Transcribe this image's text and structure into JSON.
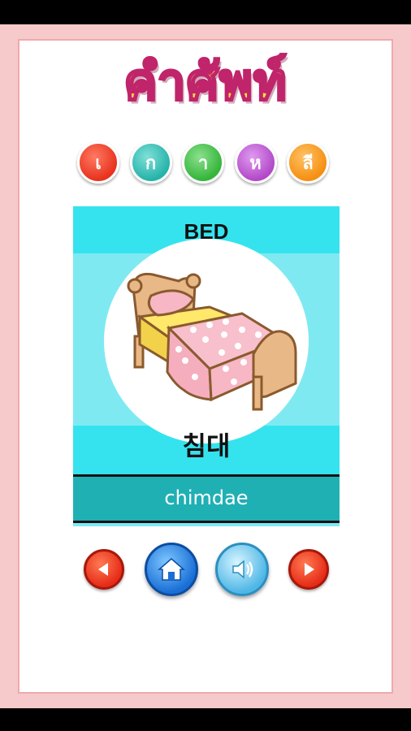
{
  "title": "คำศัพท์",
  "category_letters": [
    {
      "char": "เ",
      "color": "#e8321e"
    },
    {
      "char": "ก",
      "color": "#26b3a9"
    },
    {
      "char": "า",
      "color": "#35b53a"
    },
    {
      "char": "ห",
      "color": "#b249c8"
    },
    {
      "char": "ลี",
      "color": "#f58f12"
    }
  ],
  "card": {
    "english": "BED",
    "korean": "침대",
    "romanization": "chimdae",
    "image": "bed-illustration"
  },
  "nav": {
    "prev_icon": "arrow-left-icon",
    "home_icon": "home-icon",
    "sound_icon": "speaker-icon",
    "next_icon": "arrow-right-icon"
  }
}
